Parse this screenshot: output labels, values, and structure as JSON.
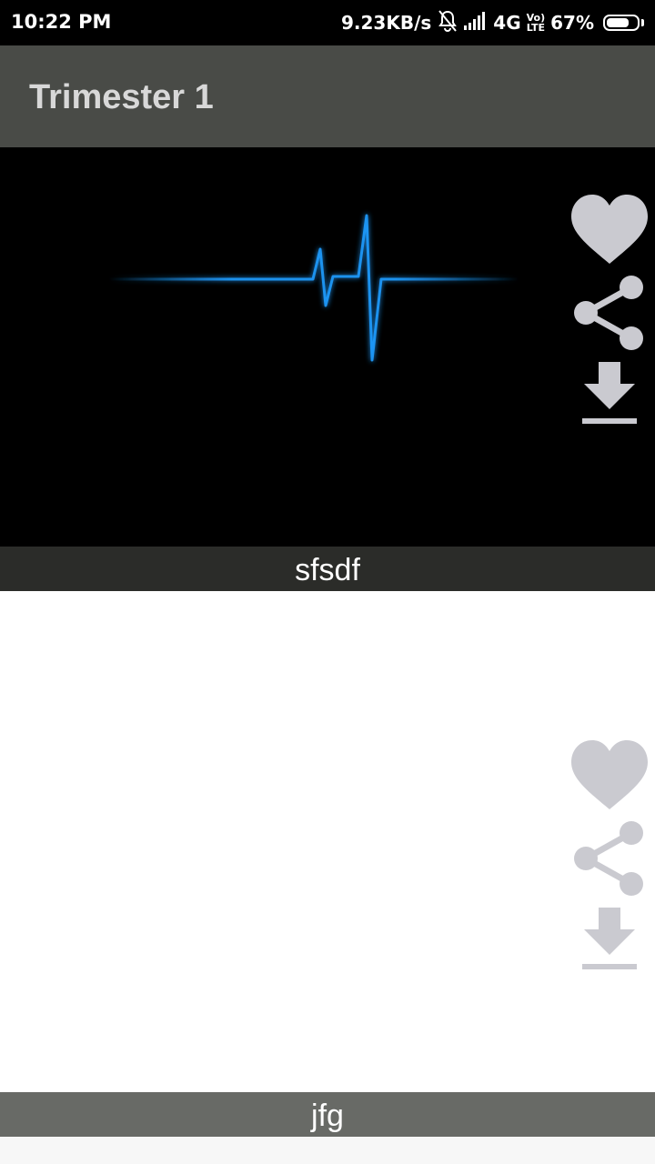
{
  "status_bar": {
    "time": "10:22 PM",
    "network_speed": "9.23KB/s",
    "network_type": "4G",
    "volte_top": "Vo)",
    "volte_bottom": "LTE",
    "battery": "67%"
  },
  "app_bar": {
    "title": "Trimester 1"
  },
  "colors": {
    "app_bar": "#494b47",
    "caption_dark": "#2b2c29",
    "caption_gray": "#686a66",
    "icon": "#cacad0",
    "heartbeat": "#1e9cff"
  },
  "cards": [
    {
      "caption": "sfsdf",
      "image": "heartbeat-line-on-black",
      "actions": [
        "heart-icon",
        "share-icon",
        "download-icon"
      ]
    },
    {
      "caption": "jfg",
      "image": "blank-white",
      "actions": [
        "heart-icon",
        "share-icon",
        "download-icon"
      ]
    }
  ]
}
